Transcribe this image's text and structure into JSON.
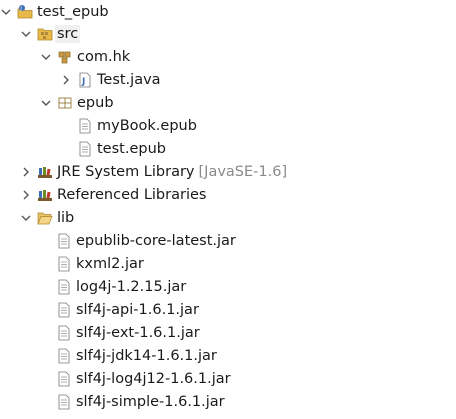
{
  "tree": {
    "project": {
      "label": "test_epub",
      "icon": "java-project-icon",
      "expanded": true
    },
    "src": {
      "label": "src",
      "icon": "source-folder-icon",
      "expanded": true
    },
    "pkg_comhk": {
      "label": "com.hk",
      "icon": "package-icon",
      "expanded": true
    },
    "file_test_java": {
      "label": "Test.java",
      "icon": "java-file-icon",
      "expanded": false
    },
    "pkg_epub": {
      "label": "epub",
      "icon": "package-icon",
      "expanded": true
    },
    "file_mybook": {
      "label": "myBook.epub",
      "icon": "file-icon"
    },
    "file_test_epub": {
      "label": "test.epub",
      "icon": "file-icon"
    },
    "jre": {
      "label": "JRE System Library",
      "decoration": "[JavaSE-1.6]",
      "icon": "library-icon",
      "expanded": false
    },
    "ref_libs": {
      "label": "Referenced Libraries",
      "icon": "library-icon",
      "expanded": false
    },
    "lib": {
      "label": "lib",
      "icon": "folder-icon",
      "expanded": true
    },
    "jars": [
      {
        "label": "epublib-core-latest.jar"
      },
      {
        "label": "kxml2.jar"
      },
      {
        "label": "log4j-1.2.15.jar"
      },
      {
        "label": "slf4j-api-1.6.1.jar"
      },
      {
        "label": "slf4j-ext-1.6.1.jar"
      },
      {
        "label": "slf4j-jdk14-1.6.1.jar"
      },
      {
        "label": "slf4j-log4j12-1.6.1.jar"
      },
      {
        "label": "slf4j-simple-1.6.1.jar"
      }
    ]
  },
  "colors": {
    "chevron": "#555555",
    "folder": "#e8b84a",
    "package": "#b08a3a",
    "java": "#3c6fb5",
    "library": "#6b8e23",
    "decoration": "#8a8a8a"
  }
}
